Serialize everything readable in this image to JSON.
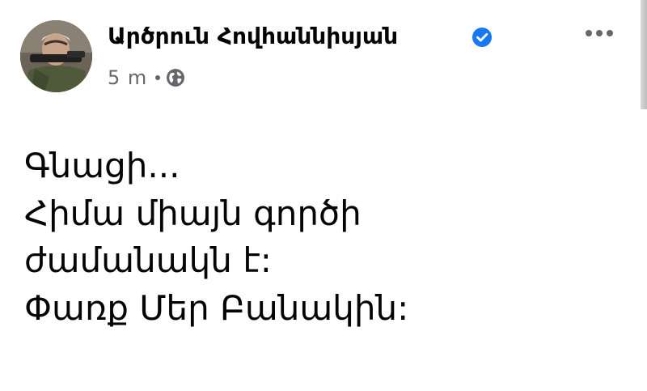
{
  "post": {
    "author": {
      "name": "Արծրուն Հովհաննիսյան",
      "verified": true,
      "avatar_icon": "profile-photo"
    },
    "meta": {
      "timestamp": "5 m",
      "audience_icon": "globe-icon"
    },
    "more_icon": "ellipsis-horizontal-icon",
    "body_lines": [
      "Գնացի...",
      "Հիմա միայն գործի",
      "ժամանակն է:",
      "Փառք Մեր Բանակին:"
    ]
  },
  "colors": {
    "text_primary": "#050505",
    "text_secondary": "#65676b",
    "verified_badge": "#1877f2",
    "background": "#ffffff"
  }
}
